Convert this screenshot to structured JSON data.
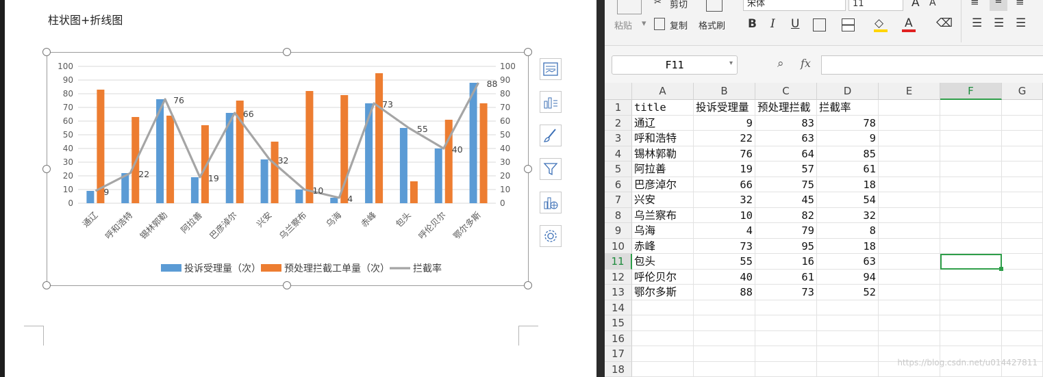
{
  "document": {
    "title": "柱状图+折线图"
  },
  "chart_data": {
    "type": "bar",
    "title": "",
    "categories": [
      "通辽",
      "呼和浩特",
      "锡林郭勒",
      "阿拉善",
      "巴彦淖尔",
      "兴安",
      "乌兰察布",
      "乌海",
      "赤峰",
      "包头",
      "呼伦贝尔",
      "鄂尔多斯"
    ],
    "series": [
      {
        "name": "投诉受理量（次）",
        "type": "bar",
        "color": "#5b9bd5",
        "values": [
          9,
          22,
          76,
          19,
          66,
          32,
          10,
          4,
          73,
          55,
          40,
          88
        ]
      },
      {
        "name": "预处理拦截工单量（次）",
        "type": "bar",
        "color": "#ed7d31",
        "values": [
          83,
          63,
          64,
          57,
          75,
          45,
          82,
          79,
          95,
          16,
          61,
          73
        ]
      },
      {
        "name": "拦截率",
        "type": "line",
        "color": "#a5a5a5",
        "values": [
          9,
          22,
          76,
          19,
          66,
          32,
          10,
          4,
          73,
          55,
          40,
          88
        ]
      }
    ],
    "line_labels": [
      "9",
      "22",
      "76",
      "19",
      "66",
      "32",
      "10",
      "4",
      "73",
      "55",
      "40",
      "88"
    ],
    "y_ticks": [
      "0",
      "10",
      "20",
      "30",
      "40",
      "50",
      "60",
      "70",
      "80",
      "90",
      "100"
    ],
    "ylim": [
      0,
      100
    ],
    "y2lim": [
      0,
      100
    ],
    "legend": "bottom",
    "grid": true
  },
  "ribbon": {
    "cut": "剪切",
    "copy": "复制",
    "paste": "粘贴",
    "format_painter": "格式刷",
    "font_name": "宋体",
    "font_size": "11",
    "bold": "B",
    "italic": "I",
    "underline": "U",
    "font_grow": "A",
    "font_shrink": "A",
    "font_color_glyph": "A"
  },
  "formula_bar": {
    "name_box": "F11",
    "fx": "fx",
    "formula": ""
  },
  "sheet": {
    "columns": [
      "A",
      "B",
      "C",
      "D",
      "E",
      "F",
      "G"
    ],
    "row_numbers": [
      "1",
      "2",
      "3",
      "4",
      "5",
      "6",
      "7",
      "8",
      "9",
      "10",
      "11",
      "12",
      "13",
      "14",
      "15",
      "16",
      "17",
      "18"
    ],
    "selected_cell": "F11",
    "rows": [
      [
        "title",
        "投诉受理量",
        "预处理拦截",
        "拦截率"
      ],
      [
        "通辽",
        "9",
        "83",
        "78"
      ],
      [
        "呼和浩特",
        "22",
        "63",
        "9"
      ],
      [
        "锡林郭勒",
        "76",
        "64",
        "85"
      ],
      [
        "阿拉善",
        "19",
        "57",
        "61"
      ],
      [
        "巴彦淖尔",
        "66",
        "75",
        "18"
      ],
      [
        "兴安",
        "32",
        "45",
        "54"
      ],
      [
        "乌兰察布",
        "10",
        "82",
        "32"
      ],
      [
        "乌海",
        "4",
        "79",
        "8"
      ],
      [
        "赤峰",
        "73",
        "95",
        "18"
      ],
      [
        "包头",
        "55",
        "16",
        "63"
      ],
      [
        "呼伦贝尔",
        "40",
        "61",
        "94"
      ],
      [
        "鄂尔多斯",
        "88",
        "73",
        "52"
      ]
    ]
  },
  "watermark": "https://blog.csdn.net/u014427811"
}
